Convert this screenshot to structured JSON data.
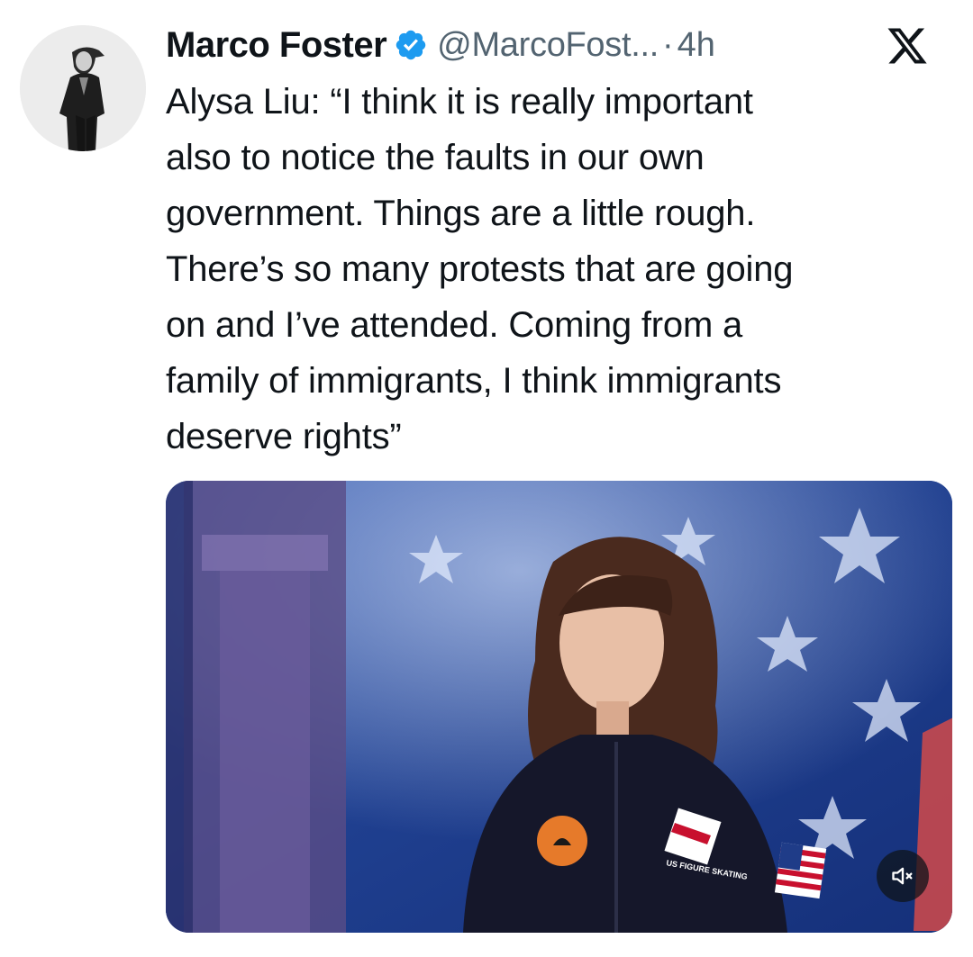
{
  "tweet": {
    "author_name": "Marco Foster",
    "author_handle": "@MarcoFost...",
    "separator": "·",
    "timestamp": "4h",
    "text": "Alysa Liu: “I think it is really important\nalso to notice the faults in our own\ngovernment. Things are a little rough.\nThere’s so many protests that are going\non and I’ve attended. Coming from a\nfamily of immigrants, I think immigrants\ndeserve rights”"
  },
  "media": {
    "type": "video",
    "badge_text": "US FIGURE SKATING",
    "mute_state": "muted"
  },
  "icons": {
    "verified": "verified-badge-icon",
    "platform": "x-logo-icon",
    "mute": "speaker-muted-icon"
  },
  "colors": {
    "verified_blue": "#1d9bf0",
    "text_primary": "#0f1419",
    "text_secondary": "#536471"
  }
}
